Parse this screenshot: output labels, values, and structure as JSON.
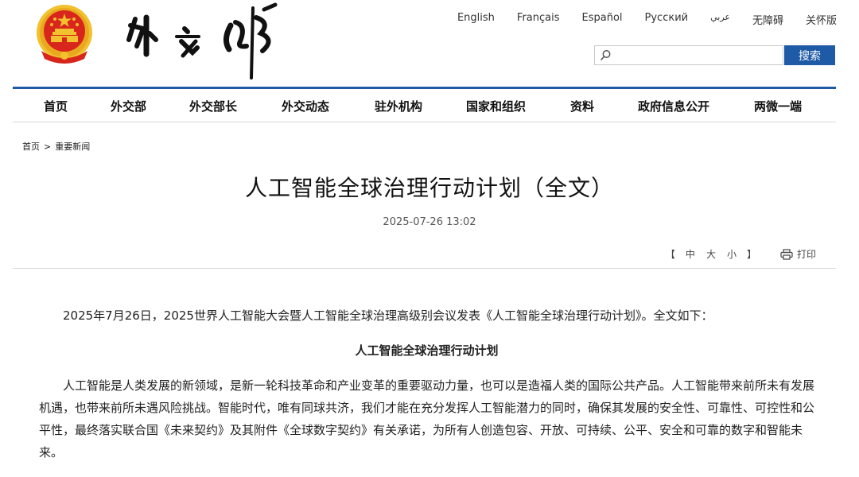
{
  "header": {
    "languages": [
      "English",
      "Français",
      "Español",
      "Русский",
      "عربي",
      "无障碍",
      "关怀版"
    ],
    "search": {
      "placeholder": "",
      "button_label": "搜索"
    },
    "logo_text": "外交部"
  },
  "nav": {
    "items": [
      "首页",
      "外交部",
      "外交部长",
      "外交动态",
      "驻外机构",
      "国家和组织",
      "资料",
      "政府信息公开",
      "两微一端"
    ]
  },
  "breadcrumb": {
    "home": "首页",
    "separator": ">",
    "current": "重要新闻"
  },
  "article": {
    "title": "人工智能全球治理行动计划（全文）",
    "date": "2025-07-26 13:02",
    "tools": {
      "bracket_open": "【",
      "font_large": "中",
      "font_medium": "大",
      "font_small": "小",
      "bracket_close": "】",
      "print_label": "打印"
    },
    "intro": "2025年7月26日，2025世界人工智能大会暨人工智能全球治理高级别会议发表《人工智能全球治理行动计划》。全文如下：",
    "sub_title": "人工智能全球治理行动计划",
    "paragraph1": "人工智能是人类发展的新领域，是新一轮科技革命和产业变革的重要驱动力量，也可以是造福人类的国际公共产品。人工智能带来前所未有发展机遇，也带来前所未遇风险挑战。智能时代，唯有同球共济，我们才能在充分发挥人工智能潜力的同时，确保其发展的安全性、可靠性、可控性和公平性，最终落实联合国《未来契约》及其附件《全球数字契约》有关承诺，为所有人创造包容、开放、可持续、公平、安全和可靠的数字和智能未来。"
  },
  "colors": {
    "brand_blue": "#1f5aa6",
    "emblem_red": "#d8261c",
    "emblem_gold": "#f2c12e"
  }
}
